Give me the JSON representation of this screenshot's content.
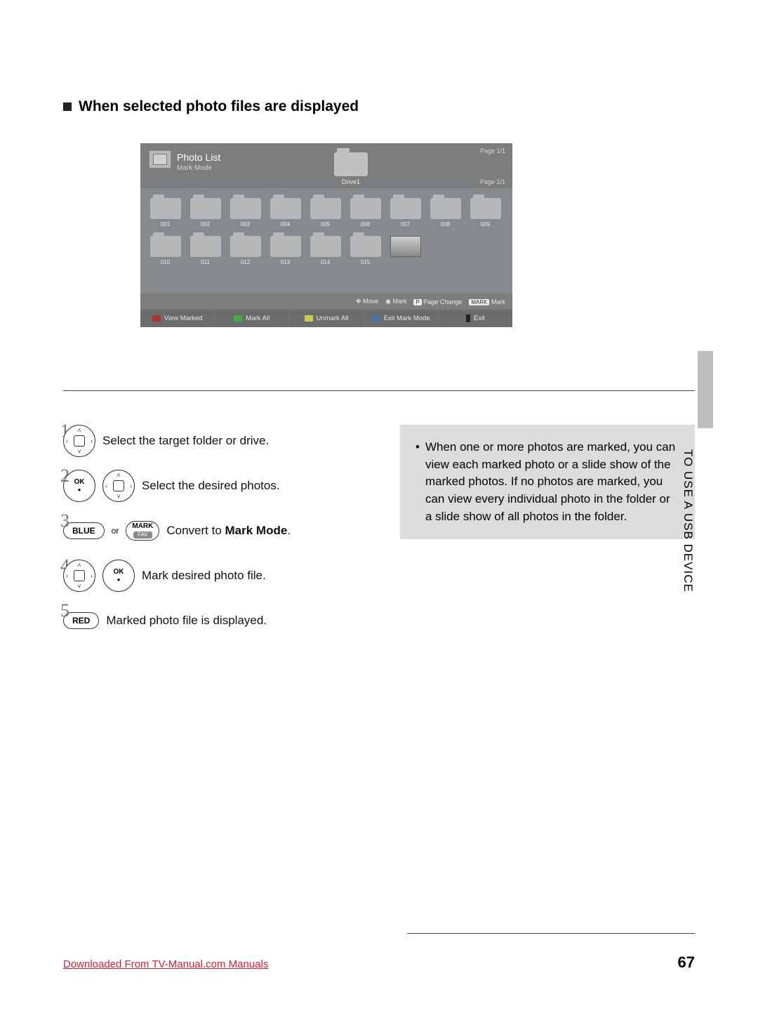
{
  "heading": "When selected photo files are displayed",
  "tv": {
    "title": "Photo List",
    "subtitle": "Mark Mode",
    "drive_label": "Drive1",
    "page_top": "Page 1/1",
    "page_side": "Page 1/1",
    "folders_row1": [
      "001",
      "002",
      "003",
      "004",
      "005",
      "006",
      "007",
      "008",
      "009"
    ],
    "folders_row2": [
      "010",
      "011",
      "012",
      "013",
      "014",
      "015"
    ],
    "hints": {
      "move": "Move",
      "mark": "Mark",
      "p_badge": "P",
      "page_change": "Page Change",
      "mark_badge": "MARK",
      "mark2": "Mark"
    },
    "actions": {
      "view_marked": "View Marked",
      "mark_all": "Mark All",
      "unmark_all": "Unmark All",
      "exit_mark_mode": "Exit Mark Mode",
      "exit": "Exit"
    }
  },
  "steps": {
    "s1": "Select the target folder or drive.",
    "s2": "Select the desired photos.",
    "s3_pre": "Convert to ",
    "s3_bold": "Mark Mode",
    "s3_post": ".",
    "s4": "Mark desired photo file.",
    "s5": "Marked photo file is displayed.",
    "blue_label": "BLUE",
    "or": "or",
    "mark_label": "MARK",
    "fav_label": "FAV",
    "ok_label": "OK",
    "red_label": "RED"
  },
  "note": "When one or more photos are marked, you can view each marked photo or a slide show of the marked photos. If no photos are marked, you can view every individual photo in the folder or a slide show of all photos in the folder.",
  "side_tab": "TO USE A USB DEVICE",
  "page_number": "67",
  "download_link": "Downloaded From TV-Manual.com Manuals"
}
